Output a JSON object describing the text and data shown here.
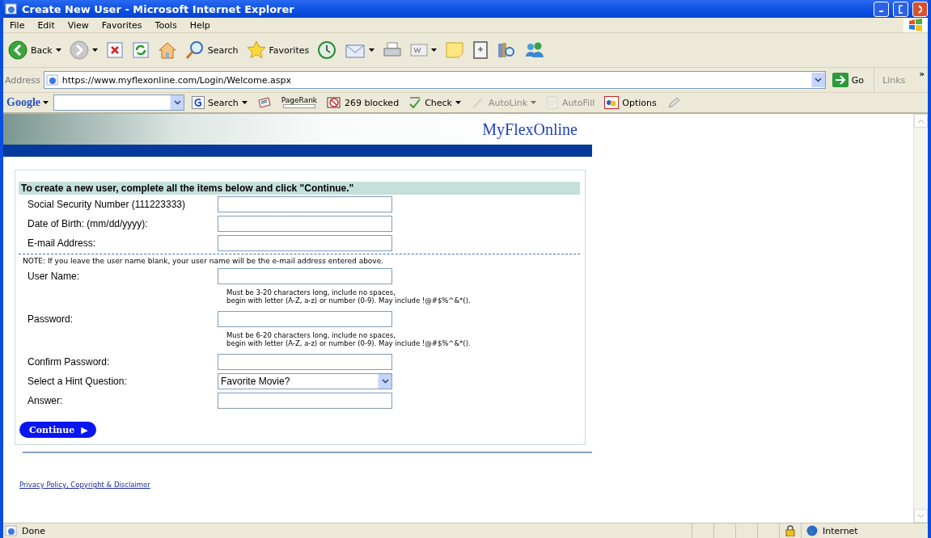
{
  "window": {
    "title": "Create New User - Microsoft Internet Explorer"
  },
  "menu": [
    "File",
    "Edit",
    "View",
    "Favorites",
    "Tools",
    "Help"
  ],
  "toolbar": [
    {
      "kind": "back",
      "label": "Back",
      "dropdown": true
    },
    {
      "kind": "forward",
      "dropdown": true
    },
    {
      "kind": "stop"
    },
    {
      "kind": "refresh"
    },
    {
      "kind": "home"
    },
    {
      "kind": "search",
      "label": "Search"
    },
    {
      "kind": "favorites",
      "label": "Favorites"
    },
    {
      "kind": "history"
    },
    {
      "kind": "mail",
      "dropdown": true
    },
    {
      "kind": "print"
    },
    {
      "kind": "word",
      "dropdown": true
    },
    {
      "kind": "note"
    },
    {
      "kind": "messenger-box"
    },
    {
      "kind": "research"
    },
    {
      "kind": "people"
    }
  ],
  "address": {
    "label": "Address",
    "value": "https://www.myflexonline.com/Login/Welcome.aspx",
    "go": "Go",
    "links": "Links",
    "more": "»"
  },
  "google_bar": {
    "logo": "Google",
    "items": [
      {
        "kind": "search",
        "label": "Search",
        "disabled": false
      },
      {
        "kind": "news",
        "disabled": false
      },
      {
        "kind": "pagerank",
        "label": "PageRank",
        "disabled": false
      },
      {
        "kind": "blocked",
        "label": "269 blocked",
        "disabled": false
      },
      {
        "kind": "check",
        "label": "Check",
        "disabled": false
      },
      {
        "kind": "autolink",
        "label": "AutoLink",
        "disabled": true
      },
      {
        "kind": "autofill",
        "label": "AutoFill",
        "disabled": true
      },
      {
        "kind": "options",
        "label": "Options",
        "disabled": false
      },
      {
        "kind": "pen",
        "disabled": false
      }
    ]
  },
  "page": {
    "brand": "MyFlexOnline",
    "heading": "To create a new user, complete all the items below and click  \"Continue.\"",
    "form": [
      {
        "kind": "text",
        "label": "Social Security Number (111223333)"
      },
      {
        "kind": "text",
        "label": "Date of Birth: (mm/dd/yyyy):"
      },
      {
        "kind": "text",
        "label": "E-mail Address:"
      },
      {
        "kind": "note",
        "text": "NOTE: If you leave the user name blank, your user name will be the e-mail address entered above."
      },
      {
        "kind": "text",
        "label": "User Name:"
      },
      {
        "kind": "hint",
        "lines": [
          "Must be 3-20 characters long, include no spaces,",
          "begin with letter (A-Z, a-z) or number (0-9). May include !@#$%^&*()."
        ]
      },
      {
        "kind": "text",
        "label": "Password:"
      },
      {
        "kind": "hint",
        "lines": [
          "Must be 6-20 characters long, include no spaces,",
          "begin with letter (A-Z, a-z) or number (0-9). May include !@#$%^&*()."
        ]
      },
      {
        "kind": "text",
        "label": "Confirm Password:"
      },
      {
        "kind": "select",
        "label": "Select a Hint Question:",
        "value": "Favorite Movie?"
      },
      {
        "kind": "text",
        "label": "Answer:"
      }
    ],
    "continue": "Continue",
    "continue_arrow": "▶",
    "footer_link": "Privacy Policy, Copyright & Disclaimer"
  },
  "status": {
    "text": "Done",
    "zone": "Internet"
  }
}
